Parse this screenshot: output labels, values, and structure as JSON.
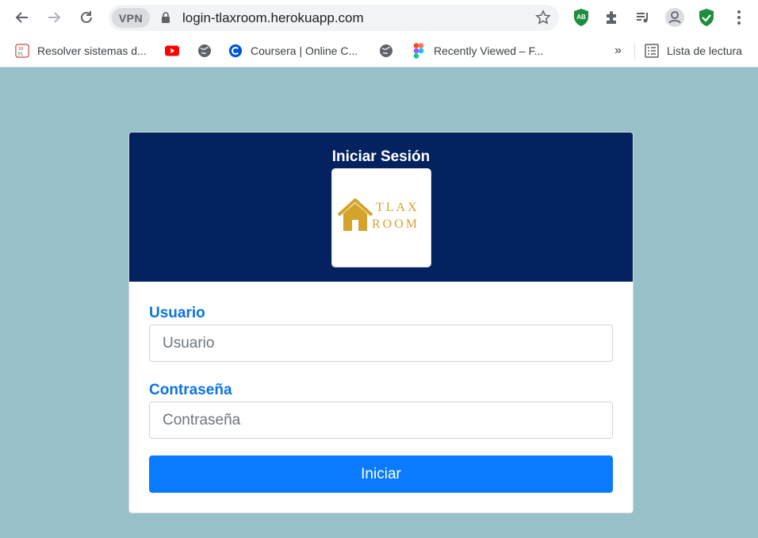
{
  "browser": {
    "url": "login-tlaxroom.herokuapp.com",
    "vpn_label": "VPN",
    "extension_ab_label": "AB",
    "bookmarks": [
      {
        "label": "Resolver sistemas d...",
        "icon": "binary-icon"
      },
      {
        "label": "",
        "icon": "youtube-icon"
      },
      {
        "label": "",
        "icon": "globe-icon"
      },
      {
        "label": "Coursera | Online C...",
        "icon": "coursera-icon"
      },
      {
        "label": "",
        "icon": "globe-icon"
      },
      {
        "label": "Recently Viewed – F...",
        "icon": "figma-icon"
      }
    ],
    "overflow_label": "»",
    "reading_list_label": "Lista de lectura"
  },
  "login": {
    "title": "Iniciar Sesión",
    "logo": {
      "line1": "TLAX",
      "line2": "ROOM"
    },
    "username": {
      "label": "Usuario",
      "placeholder": "Usuario",
      "value": ""
    },
    "password": {
      "label": "Contraseña",
      "placeholder": "Contraseña",
      "value": ""
    },
    "submit_label": "Iniciar"
  },
  "colors": {
    "page_background": "#97c0c9",
    "header_background": "#042260",
    "accent": "#0a7bff",
    "label": "#0a74e6",
    "logo_gold": "#d4a42a"
  }
}
